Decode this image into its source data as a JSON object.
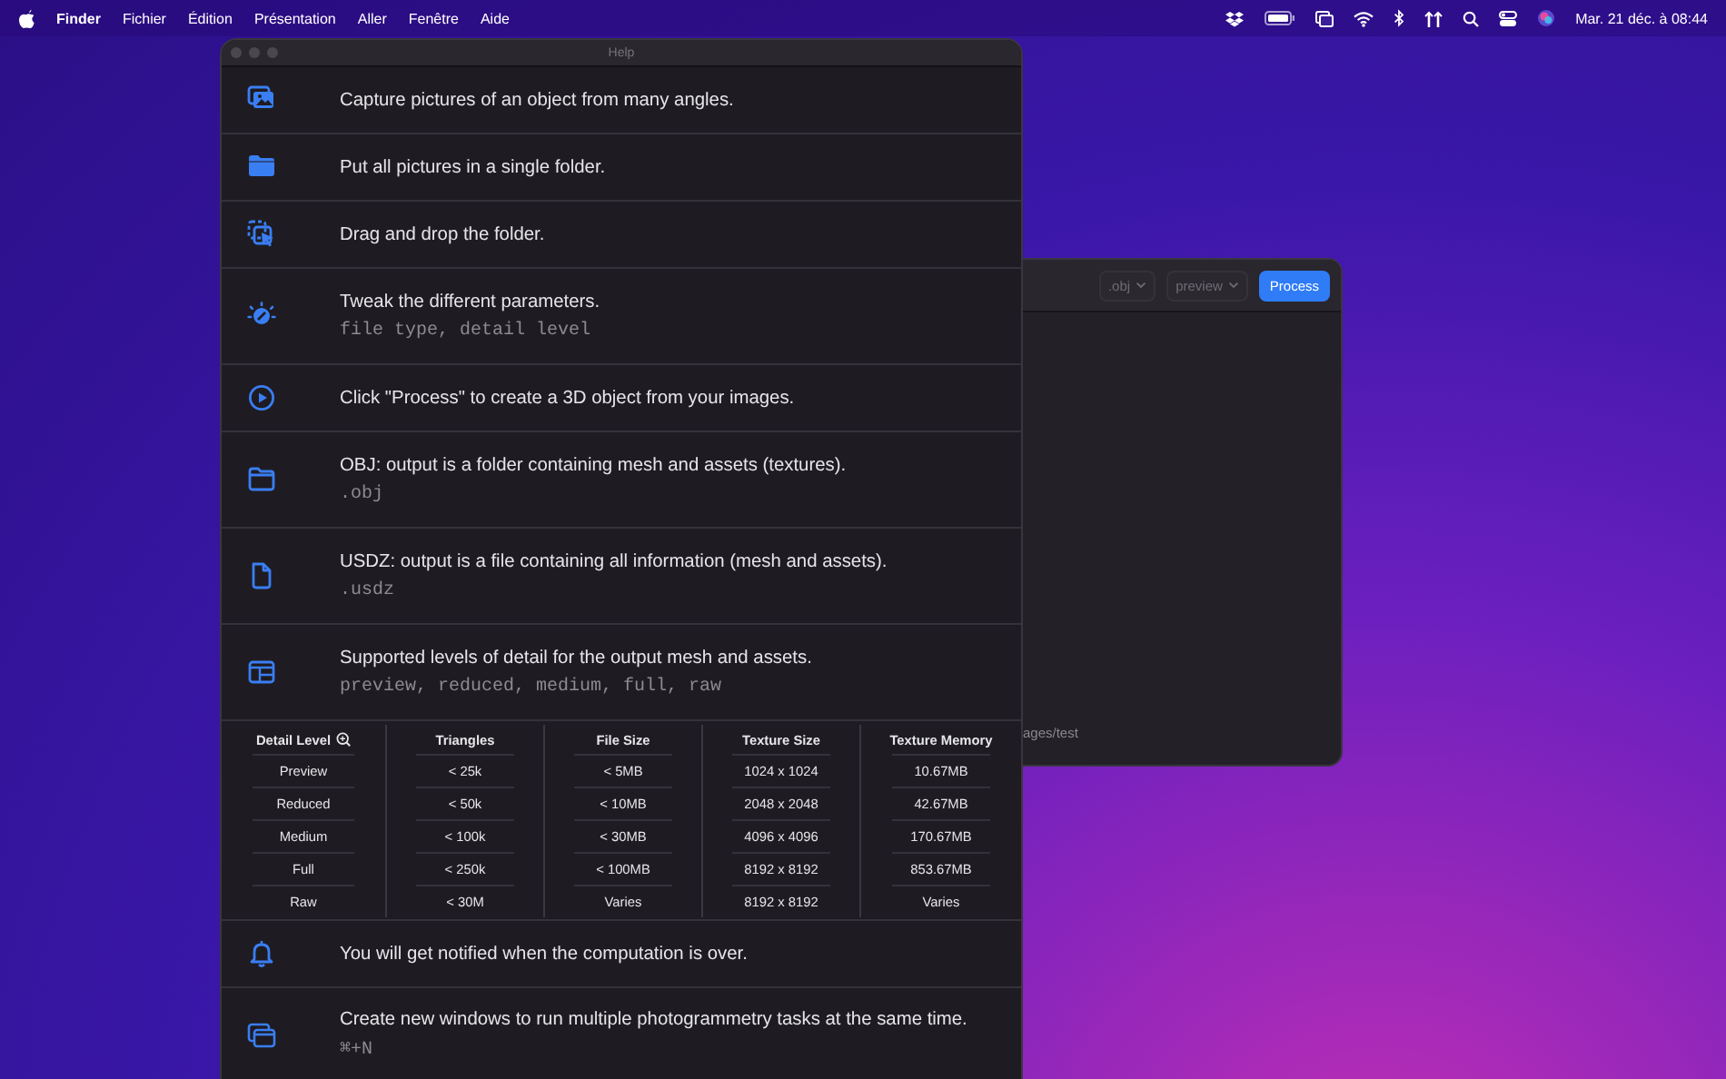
{
  "menu_bar": {
    "app_name": "Finder",
    "menus": [
      "Fichier",
      "Édition",
      "Présentation",
      "Aller",
      "Fenêtre",
      "Aide"
    ],
    "clock": "Mar. 21 déc. à 08:44"
  },
  "back_window": {
    "format": ".obj",
    "detail": "preview",
    "process_button": "Process",
    "path": "ages/test"
  },
  "help_window": {
    "title": "Help",
    "steps": [
      {
        "kind": "photos",
        "text": "Capture pictures of an object from many angles."
      },
      {
        "kind": "folder-fill",
        "text": "Put all pictures in a single folder."
      },
      {
        "kind": "drag",
        "text": "Drag and drop the folder."
      },
      {
        "kind": "gauge",
        "text": "Tweak the different parameters.",
        "detail": "file type, detail level"
      },
      {
        "kind": "play",
        "text": "Click \"Process\" to create a 3D object from your images."
      },
      {
        "kind": "folder",
        "text": "OBJ: output is a folder containing mesh and assets (textures).",
        "detail": ".obj"
      },
      {
        "kind": "document",
        "text": "USDZ: output is a file containing all information (mesh and assets).",
        "detail": ".usdz"
      },
      {
        "kind": "layout",
        "text": "Supported levels of detail for the output mesh and assets.",
        "detail": "preview, reduced, medium, full, raw"
      }
    ],
    "detail_table": {
      "columns": [
        "Detail Level",
        "Triangles",
        "File Size",
        "Texture Size",
        "Texture Memory"
      ],
      "rows": [
        [
          "Preview",
          "< 25k",
          "< 5MB",
          "1024 x 1024",
          "10.67MB"
        ],
        [
          "Reduced",
          "< 50k",
          "< 10MB",
          "2048 x 2048",
          "42.67MB"
        ],
        [
          "Medium",
          "< 100k",
          "< 30MB",
          "4096 x 4096",
          "170.67MB"
        ],
        [
          "Full",
          "< 250k",
          "< 100MB",
          "8192 x 8192",
          "853.67MB"
        ],
        [
          "Raw",
          "< 30M",
          "Varies",
          "8192 x 8192",
          "Varies"
        ]
      ]
    },
    "more_steps": [
      {
        "kind": "bell",
        "text": "You will get notified when the computation is over."
      },
      {
        "kind": "windows",
        "text": "Create new windows to run multiple photogrammetry tasks at the same time.",
        "detail": "⌘+N"
      }
    ]
  }
}
